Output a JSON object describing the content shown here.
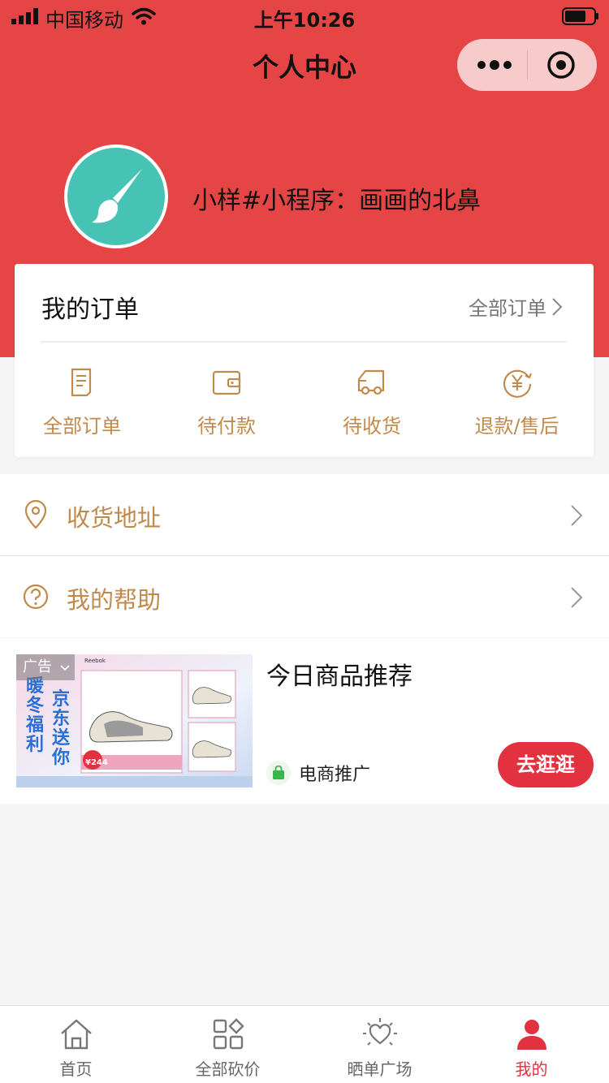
{
  "status_bar": {
    "carrier": "中国移动",
    "time": "上午10:26"
  },
  "nav": {
    "title": "个人中心"
  },
  "profile": {
    "nickname": "小样#小程序：画画的北鼻"
  },
  "orders": {
    "title": "我的订单",
    "view_all_label": "全部订单",
    "items": [
      {
        "label": "全部订单",
        "icon": "order-list-icon"
      },
      {
        "label": "待付款",
        "icon": "wallet-icon"
      },
      {
        "label": "待收货",
        "icon": "delivery-truck-icon"
      },
      {
        "label": "退款/售后",
        "icon": "refund-yen-icon"
      }
    ]
  },
  "menu": {
    "items": [
      {
        "label": "收货地址",
        "icon": "location-pin-icon"
      },
      {
        "label": "我的帮助",
        "icon": "help-circle-icon"
      }
    ]
  },
  "ad": {
    "tag": "广告",
    "title": "今日商品推荐",
    "source": "电商推广",
    "button_label": "去逛逛",
    "image_text": {
      "left": "暖冬福利",
      "right": "京东送你",
      "brand": "Reebok",
      "price": "¥244"
    }
  },
  "tabbar": {
    "items": [
      {
        "label": "首页",
        "icon": "home-icon",
        "active": false
      },
      {
        "label": "全部砍价",
        "icon": "grid-icon",
        "active": false
      },
      {
        "label": "晒单广场",
        "icon": "heart-sun-icon",
        "active": false
      },
      {
        "label": "我的",
        "icon": "person-icon",
        "active": true
      }
    ]
  },
  "colors": {
    "header_red": "#e64545",
    "accent_gold": "#c08a4c",
    "button_red": "#e2323f",
    "avatar_teal": "#47c3b5"
  }
}
